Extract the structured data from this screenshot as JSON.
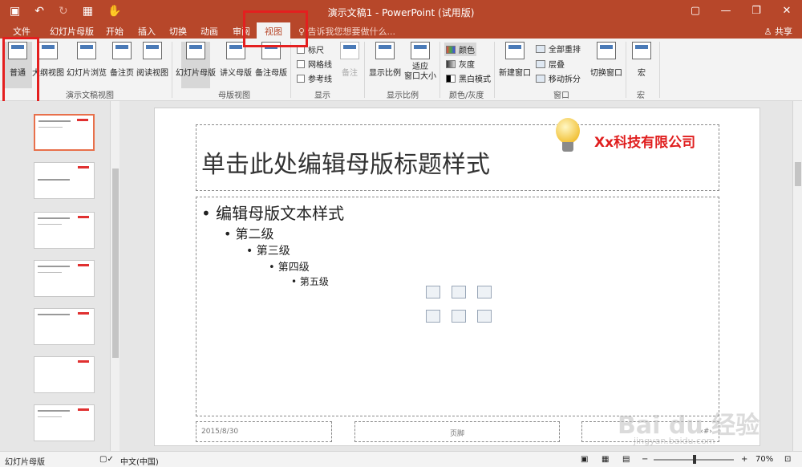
{
  "window": {
    "title": "演示文稿1 - PowerPoint (试用版)",
    "controls": [
      "▢",
      "—",
      "❐",
      "✕"
    ]
  },
  "qat": {
    "save": "▣",
    "undo": "↶",
    "redo": "↻",
    "present": "▦",
    "touch": "✋"
  },
  "tabs": [
    {
      "label": "文件"
    },
    {
      "label": "幻灯片母版"
    },
    {
      "label": "开始"
    },
    {
      "label": "插入"
    },
    {
      "label": "切换"
    },
    {
      "label": "动画"
    },
    {
      "label": "审阅"
    },
    {
      "label": "视图"
    }
  ],
  "tell_me": "♀ 告诉我您想要做什么...",
  "share": "♙ 共享",
  "ribbon": {
    "presentation_views": {
      "label": "演示文稿视图",
      "buttons": [
        "普通",
        "大纲视图",
        "幻灯片浏览",
        "备注页",
        "阅读视图"
      ]
    },
    "master_views": {
      "label": "母版视图",
      "buttons": [
        "幻灯片母版",
        "讲义母版",
        "备注母版"
      ]
    },
    "show": {
      "label": "显示",
      "checks": [
        "标尺",
        "网格线",
        "参考线"
      ],
      "notes": "备注"
    },
    "zoom": {
      "label": "显示比例",
      "buttons": [
        "显示比例",
        "适应\n窗口大小"
      ]
    },
    "color": {
      "label": "颜色/灰度",
      "items": [
        "颜色",
        "灰度",
        "黑白模式"
      ]
    },
    "window": {
      "label": "窗口",
      "new_window": "新建窗口",
      "items": [
        "全部重排",
        "层叠",
        "移动拆分"
      ],
      "switch": "切换窗口"
    },
    "macros": {
      "label": "宏",
      "button": "宏"
    }
  },
  "slide": {
    "title": "单击此处编辑母版标题样式",
    "company": "Xx科技有限公司",
    "levels": [
      "• 编辑母版文本样式",
      "• 第二级",
      "• 第三级",
      "• 第四级",
      "• 第五级"
    ],
    "date": "2015/8/30",
    "footer": "页脚",
    "page_num": "‹#›"
  },
  "status": {
    "view": "幻灯片母版",
    "language": "中文(中国)",
    "zoom": "70%"
  },
  "watermark": {
    "main": "Bai du 经验",
    "sub": "jingyan.baidu.com"
  }
}
